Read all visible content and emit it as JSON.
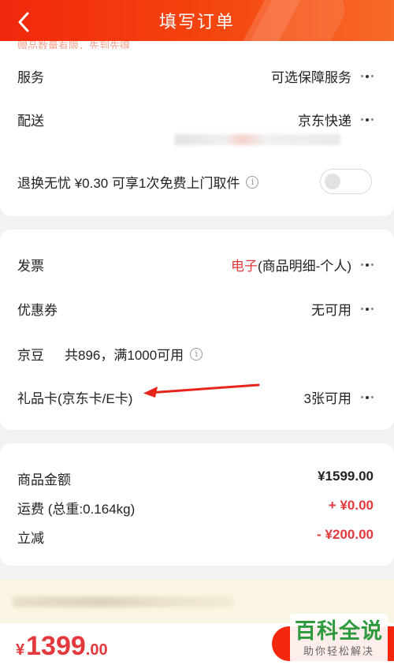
{
  "header": {
    "title": "填写订单",
    "gradient_start": "#f2270c",
    "gradient_end": "#f86a2a"
  },
  "card1": {
    "cut_text": "赠品数量有限，先到先得",
    "service": {
      "label": "服务",
      "value": "可选保障服务"
    },
    "delivery": {
      "label": "配送",
      "value": "京东快递"
    },
    "return_insurance": {
      "label": "退换无忧 ¥0.30  可享1次免费上门取件",
      "toggle_on": false
    }
  },
  "card2": {
    "invoice": {
      "label": "发票",
      "value_highlight": "电子",
      "value_rest": "(商品明细-个人)"
    },
    "coupon": {
      "label": "优惠券",
      "value": "无可用"
    },
    "jingdou": {
      "label": "京豆",
      "detail": "共896，满1000可用"
    },
    "gift_card": {
      "label": "礼品卡(京东卡/E卡)",
      "value": "3张可用"
    }
  },
  "card3": {
    "goods_amount": {
      "label": "商品金额",
      "value": "¥1599.00"
    },
    "shipping": {
      "label": "运费 (总重:0.164kg)",
      "value": "+ ¥0.00"
    },
    "discount": {
      "label": "立减",
      "value": "- ¥200.00"
    }
  },
  "bottom": {
    "yen": "¥",
    "total_int": "1399",
    "total_dec": ".00",
    "accent": "#e4393c"
  },
  "watermark": {
    "main": "百科全说",
    "sub": "助你轻松解决"
  }
}
